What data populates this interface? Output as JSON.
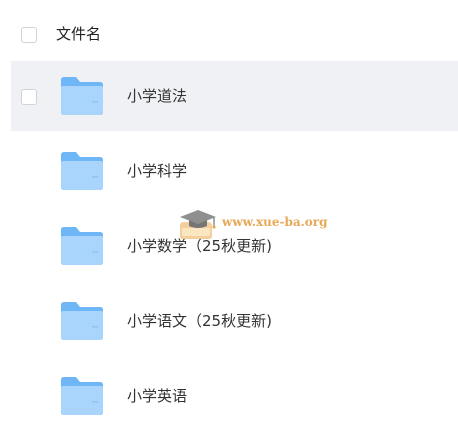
{
  "header": {
    "column_label": "文件名"
  },
  "files": [
    {
      "name": "小学道法",
      "icon": "folder-icon",
      "selected_highlight": true
    },
    {
      "name": "小学科学",
      "icon": "folder-icon",
      "selected_highlight": false
    },
    {
      "name": "小学数学（25秋更新)",
      "icon": "folder-icon",
      "selected_highlight": false
    },
    {
      "name": "小学语文（25秋更新)",
      "icon": "folder-icon",
      "selected_highlight": false
    },
    {
      "name": "小学英语",
      "icon": "folder-icon",
      "selected_highlight": false
    }
  ],
  "watermark": {
    "text": "www.xue-ba.org",
    "icon": "graduation-cap-icon"
  },
  "colors": {
    "row_hover_bg": "#f0f1f5",
    "folder_light": "#a9d4fb",
    "folder_dark": "#6fb6f6",
    "watermark_text": "#e59a3a"
  }
}
